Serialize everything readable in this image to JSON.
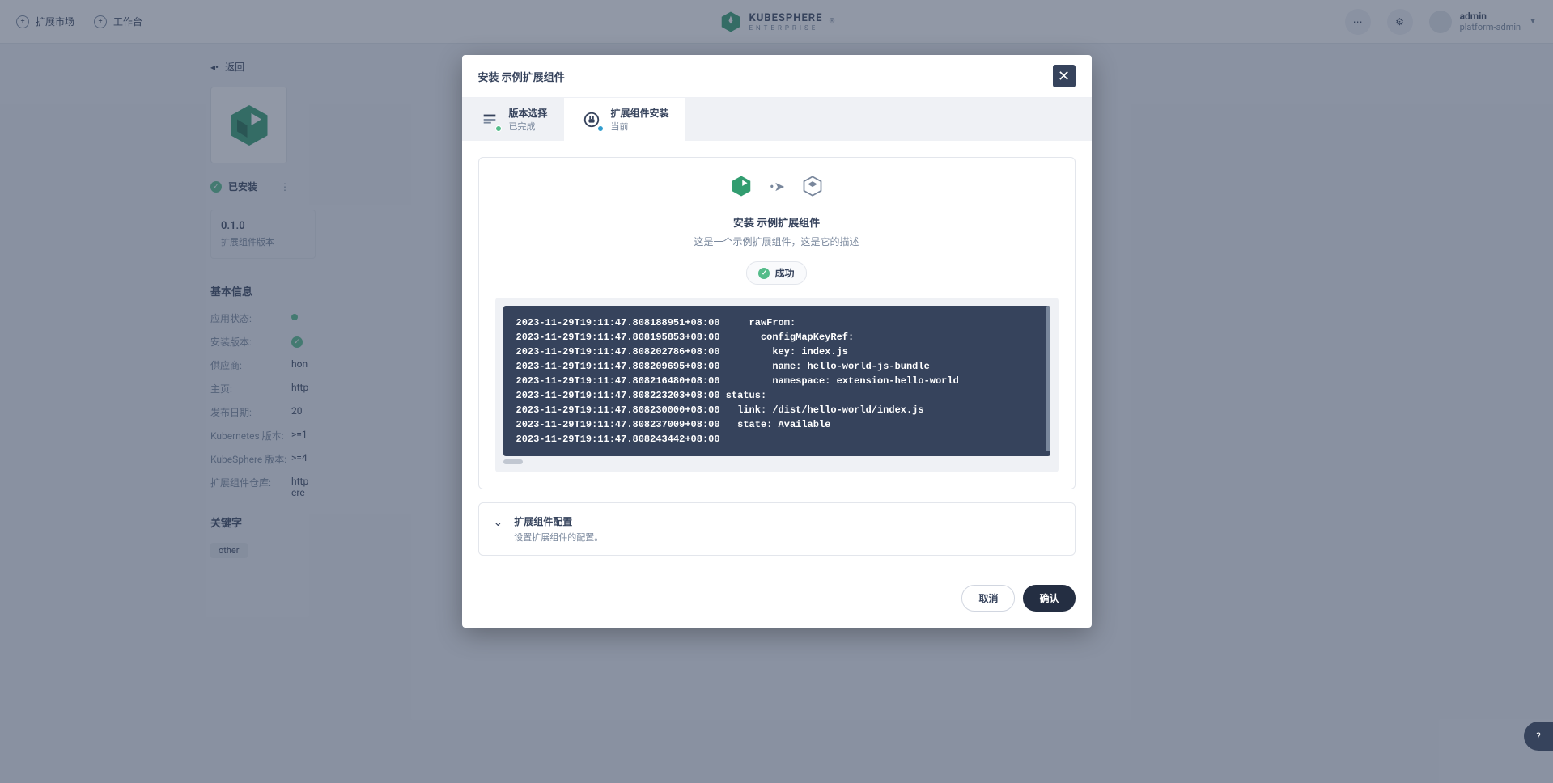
{
  "header": {
    "nav1": "扩展市场",
    "nav2": "工作台",
    "brand_main": "KUBESPHERE",
    "brand_sub": "ENTERPRISE",
    "user_name": "admin",
    "user_role": "platform-admin"
  },
  "detail": {
    "back": "返回",
    "installed": "已安装",
    "version": "0.1.0",
    "version_label": "扩展组件版本",
    "basic_info": "基本信息",
    "fields": {
      "app_status": "应用状态:",
      "install_version": "安装版本:",
      "vendor": "供应商:",
      "vendor_v": "hon",
      "homepage": "主页:",
      "homepage_v": "http",
      "release_date": "发布日期:",
      "release_date_v": "20",
      "k8s_version": "Kubernetes 版本:",
      "k8s_version_v": ">=1",
      "ks_version": "KubeSphere 版本:",
      "ks_version_v": ">=4",
      "repo": "扩展组件仓库:",
      "repo_v": "http",
      "repo_v2": "ere"
    },
    "keywords_title": "关键字",
    "keyword": "other"
  },
  "modal": {
    "title": "安装 示例扩展组件",
    "step1_title": "版本选择",
    "step1_sub": "已完成",
    "step2_title": "扩展组件安装",
    "step2_sub": "当前",
    "install_title": "安装 示例扩展组件",
    "install_desc": "这是一个示例扩展组件，这是它的描述",
    "success": "成功",
    "logs": [
      "2023-11-29T19:11:47.808188951+08:00     rawFrom:",
      "2023-11-29T19:11:47.808195853+08:00       configMapKeyRef:",
      "2023-11-29T19:11:47.808202786+08:00         key: index.js",
      "2023-11-29T19:11:47.808209695+08:00         name: hello-world-js-bundle",
      "2023-11-29T19:11:47.808216480+08:00         namespace: extension-hello-world",
      "2023-11-29T19:11:47.808223203+08:00 status:",
      "2023-11-29T19:11:47.808230000+08:00   link: /dist/hello-world/index.js",
      "2023-11-29T19:11:47.808237009+08:00   state: Available",
      "2023-11-29T19:11:47.808243442+08:00"
    ],
    "config_title": "扩展组件配置",
    "config_desc": "设置扩展组件的配置。",
    "cancel": "取消",
    "confirm": "确认"
  }
}
